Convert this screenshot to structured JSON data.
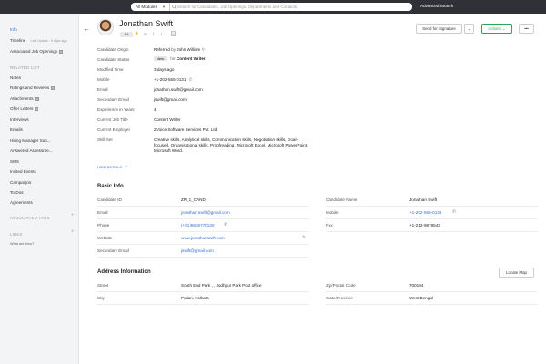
{
  "topbar": {
    "module_select": "All Modules",
    "search_placeholder": "Search for Candidates, Job Openings, Departments and Contacts",
    "advanced_search": "Advanced Search"
  },
  "sidebar": {
    "info": "Info",
    "timeline": "Timeline",
    "timeline_note": "Last Update : 5 days ago",
    "associated_job_openings": "Associated Job Openings",
    "associated_job_openings_count": "0",
    "related_list_heading": "RELATED LIST",
    "related_items": [
      {
        "label": "Notes",
        "badge": ""
      },
      {
        "label": "Ratings and Reviews",
        "badge": "0"
      },
      {
        "label": "Attachments",
        "badge": "0"
      },
      {
        "label": "Offer Letters",
        "badge": "0"
      },
      {
        "label": "Interviews",
        "badge": ""
      },
      {
        "label": "Emails",
        "badge": ""
      },
      {
        "label": "Hiring Manager Sub...",
        "badge": ""
      },
      {
        "label": "Answered Assessme...",
        "badge": ""
      },
      {
        "label": "SMS",
        "badge": ""
      },
      {
        "label": "Invited Events",
        "badge": ""
      },
      {
        "label": "Campaigns",
        "badge": ""
      },
      {
        "label": "To-Dos",
        "badge": ""
      },
      {
        "label": "Agreements",
        "badge": ""
      }
    ],
    "associated_tags_heading": "ASSOCIATED TAGS",
    "links_heading": "LINKS",
    "what_are_links": "What are links?"
  },
  "header": {
    "name": "Jonathan Swift",
    "rating": "4.6",
    "social": [
      "in",
      "f",
      "t"
    ],
    "send_for_signature": "Send for Signature",
    "actions": "Actions",
    "more": "•••"
  },
  "details": {
    "candidate_origin_label": "Candidate Origin",
    "candidate_origin_prefix": "Referred",
    "candidate_origin_by": "by",
    "candidate_origin_value": "John William",
    "candidate_status_label": "Candidate Status",
    "candidate_status_badge": "New",
    "candidate_status_for": "for",
    "candidate_status_value": "Content Writer",
    "modified_time_label": "Modified Time",
    "modified_time_value": "3 days ago",
    "mobile_label": "Mobile",
    "mobile_value": "+1-202-555-0131",
    "email_label": "Email",
    "email_value": "jonathan.swift@gmail.com",
    "secondary_email_label": "Secondary Email",
    "secondary_email_value": "jswift@gmail.com",
    "experience_label": "Experience in Years",
    "experience_value": "4",
    "current_job_title_label": "Current Job Title",
    "current_job_title_value": "Content Writer",
    "current_employer_label": "Current Employer",
    "current_employer_value": "ZVoice Software Services Pvt. Ltd.",
    "skill_set_label": "Skill Set",
    "skill_set_value": "Creative skills, Analytical skills, Communication skills, Negotiation skills, Goal-focused, Organisational skills, Proofreading, Microsoft Excel, Microsoft PowerPoint, Microsoft Word.",
    "hide_details": "HIDE DETAILS"
  },
  "basic_info": {
    "title": "Basic Info",
    "candidate_id_label": "Candidate ID",
    "candidate_id_value": "ZR_1_CAND",
    "candidate_name_label": "Candidate Name",
    "candidate_name_value": "Jonathan Swift",
    "email_label": "Email",
    "email_value": "jonathan.swift@gmail.com",
    "mobile_label": "Mobile",
    "mobile_value": "+1-202-555-0131",
    "phone_label": "Phone",
    "phone_value": "(+91)9836770130",
    "fax_label": "Fax",
    "fax_value": "+1-212-9876543",
    "website_label": "Website",
    "website_value": "www.jonathanswift.com",
    "secondary_email_label": "Secondary Email",
    "secondary_email_value": "jswift@gmail.com"
  },
  "address": {
    "title": "Address Information",
    "locate_map": "Locate Map",
    "street_label": "Street",
    "street_value": "South End Park , , Jodhpur Park Post office",
    "zip_label": "Zip/Postal Code",
    "zip_value": "700104",
    "city_label": "City",
    "city_value": "Pailan, Kolkata",
    "state_label": "State/Province",
    "state_value": "West Bengal"
  },
  "colors": {
    "topbar": "#2f3136",
    "link": "#2f6fd0",
    "actions": "#2ca45a",
    "star": "#f1a417"
  }
}
